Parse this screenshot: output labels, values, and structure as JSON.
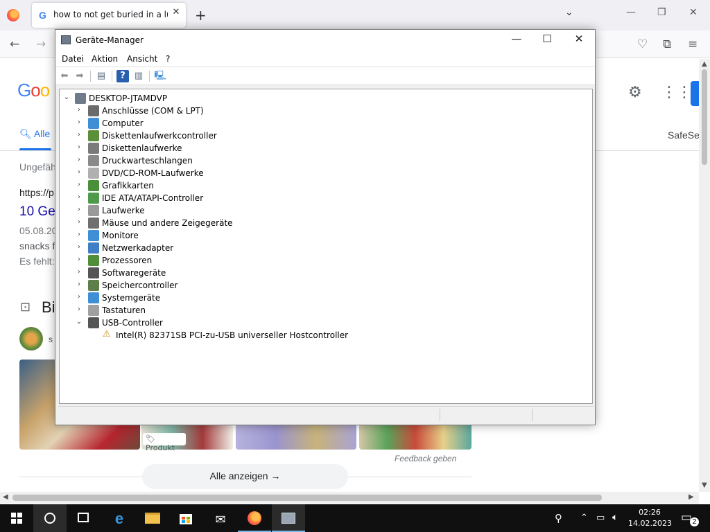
{
  "browser": {
    "tab_title": "how to not get buried in a lunch",
    "tab_close": "✕",
    "new_tab": "+",
    "list_tabs": "⌄",
    "window_minimize": "—",
    "window_restore": "❐",
    "window_close": "✕"
  },
  "google_page": {
    "logo_partial": "Goo",
    "tab_all": "Alle",
    "safesearch_partial": "SafeSe",
    "result_stats_partial": "Ungefäh",
    "result_url_partial": "https://p",
    "result_title_partial": "10 Ge",
    "result_date_partial": "05.08.20",
    "result_snippet_partial": "snacks f",
    "result_missing_partial": "Es fehlt:",
    "images_heading_partial": "Bi",
    "filter_chip_partial": "s",
    "product_badge": "Produkt",
    "feedback": "Feedback geben",
    "show_all": "Alle anzeigen"
  },
  "device_manager": {
    "title": "Geräte-Manager",
    "menu": [
      "Datei",
      "Aktion",
      "Ansicht",
      "?"
    ],
    "window_minimize": "—",
    "window_maximize": "☐",
    "window_close": "✕",
    "root": "DESKTOP-JTAMDVP",
    "categories": [
      {
        "label": "Anschlüsse (COM & LPT)",
        "icon": "port-icon",
        "color": "#6b6b6b"
      },
      {
        "label": "Computer",
        "icon": "computer-icon",
        "color": "#3f8fd6"
      },
      {
        "label": "Diskettenlaufwerkcontroller",
        "icon": "floppy-controller-icon",
        "color": "#5b8f3a"
      },
      {
        "label": "Diskettenlaufwerke",
        "icon": "floppy-drive-icon",
        "color": "#7a7a7a"
      },
      {
        "label": "Druckwarteschlangen",
        "icon": "printer-icon",
        "color": "#8a8a8a"
      },
      {
        "label": "DVD/CD-ROM-Laufwerke",
        "icon": "dvd-icon",
        "color": "#b0b0b0"
      },
      {
        "label": "Grafikkarten",
        "icon": "display-adapter-icon",
        "color": "#4a8f3a"
      },
      {
        "label": "IDE ATA/ATAPI-Controller",
        "icon": "ide-controller-icon",
        "color": "#4f9a4a"
      },
      {
        "label": "Laufwerke",
        "icon": "disk-drive-icon",
        "color": "#9a9a9a"
      },
      {
        "label": "Mäuse und andere Zeigegeräte",
        "icon": "mouse-icon",
        "color": "#6f6f6f"
      },
      {
        "label": "Monitore",
        "icon": "monitor-icon",
        "color": "#3f8fd6"
      },
      {
        "label": "Netzwerkadapter",
        "icon": "network-adapter-icon",
        "color": "#3f7fc6"
      },
      {
        "label": "Prozessoren",
        "icon": "processor-icon",
        "color": "#4f8f3a"
      },
      {
        "label": "Softwaregeräte",
        "icon": "software-device-icon",
        "color": "#555555"
      },
      {
        "label": "Speichercontroller",
        "icon": "storage-controller-icon",
        "color": "#5f7f4a"
      },
      {
        "label": "Systemgeräte",
        "icon": "system-devices-icon",
        "color": "#3f8fd6"
      },
      {
        "label": "Tastaturen",
        "icon": "keyboard-icon",
        "color": "#a0a0a0"
      },
      {
        "label": "USB-Controller",
        "icon": "usb-icon",
        "color": "#555555"
      }
    ],
    "usb_child": "Intel(R) 82371SB PCI-zu-USB universeller Hostcontroller"
  },
  "taskbar": {
    "time": "02:26",
    "date": "14.02.2023",
    "notification_count": "2",
    "accent": "#76b9ed"
  }
}
